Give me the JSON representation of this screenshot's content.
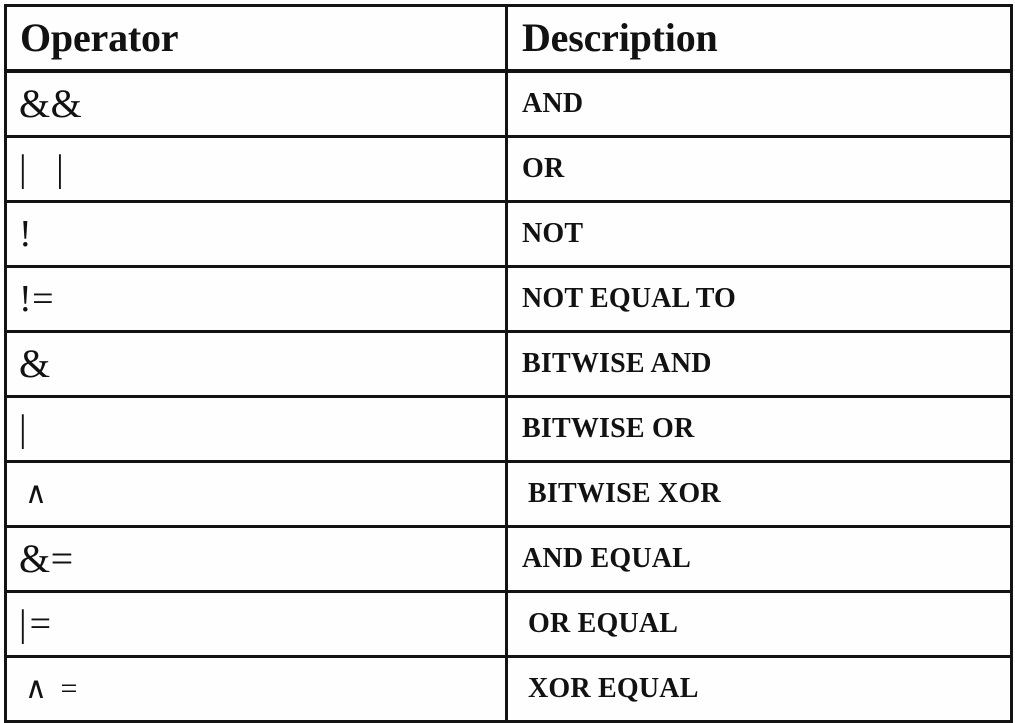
{
  "table": {
    "columns": [
      {
        "key": "operator",
        "label": "Operator"
      },
      {
        "key": "description",
        "label": "Description"
      }
    ],
    "rows": [
      {
        "operator": "&&",
        "description": "AND"
      },
      {
        "operator": "| |",
        "description": "OR"
      },
      {
        "operator": "!",
        "description": "NOT"
      },
      {
        "operator": "!=",
        "description": "NOT EQUAL TO"
      },
      {
        "operator": "&",
        "description": "BITWISE AND"
      },
      {
        "operator": "|",
        "description": "BITWISE OR"
      },
      {
        "operator": "∧",
        "description": "BITWISE XOR"
      },
      {
        "operator": "&=",
        "description": "AND EQUAL"
      },
      {
        "operator": "|=",
        "description": "OR EQUAL"
      },
      {
        "operator": "∧ =",
        "description": "XOR EQUAL"
      }
    ]
  },
  "style": {
    "border_color": "#131313",
    "background_color": "#ffffff",
    "text_color": "#121212"
  }
}
